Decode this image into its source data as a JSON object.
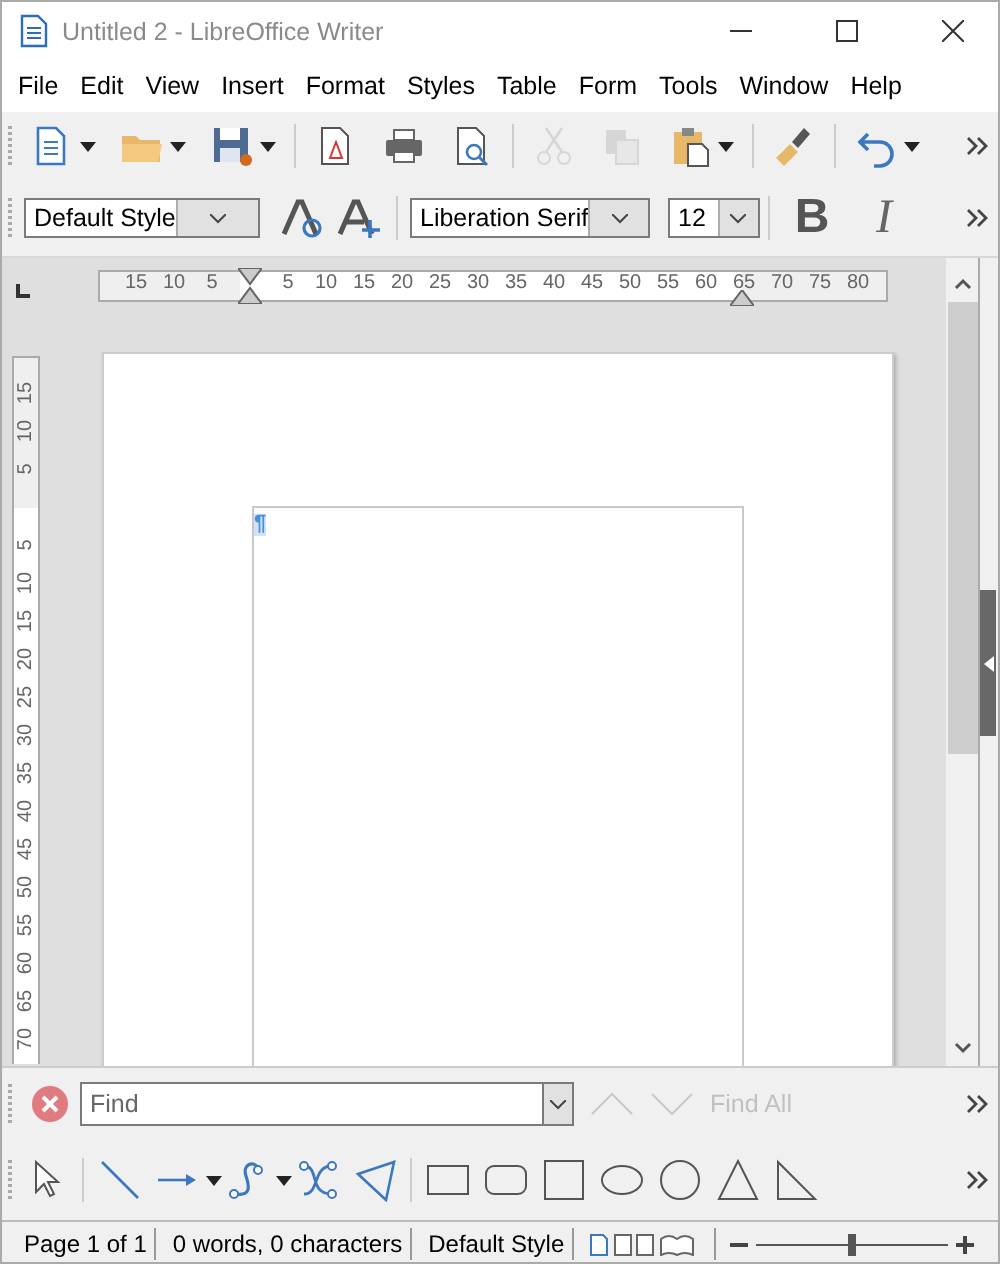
{
  "window": {
    "title": "Untitled 2 - LibreOffice Writer"
  },
  "menu": [
    "File",
    "Edit",
    "View",
    "Insert",
    "Format",
    "Styles",
    "Table",
    "Form",
    "Tools",
    "Window",
    "Help"
  ],
  "standard_toolbar": [
    [
      {
        "kind": "new",
        "dropdown": true,
        "disabled": false
      },
      {
        "kind": "open",
        "dropdown": true,
        "disabled": false
      },
      {
        "kind": "save",
        "dropdown": true,
        "disabled": false
      }
    ],
    [
      {
        "kind": "pdf",
        "dropdown": false,
        "disabled": false
      },
      {
        "kind": "print",
        "dropdown": false,
        "disabled": false
      },
      {
        "kind": "preview",
        "dropdown": false,
        "disabled": false
      }
    ],
    [
      {
        "kind": "cut",
        "dropdown": false,
        "disabled": true
      },
      {
        "kind": "copy",
        "dropdown": false,
        "disabled": true
      },
      {
        "kind": "paste",
        "dropdown": true,
        "disabled": false
      }
    ],
    [
      {
        "kind": "clone",
        "dropdown": false,
        "disabled": false
      }
    ],
    [
      {
        "kind": "undo",
        "dropdown": true,
        "disabled": false
      }
    ]
  ],
  "formatting_toolbar": {
    "paragraph_style": "Default Style",
    "font_name": "Liberation Serif",
    "font_size": "12",
    "bold": "B",
    "italic": "I"
  },
  "ruler": {
    "left_labels": [
      "15",
      "10",
      "5"
    ],
    "right_labels": [
      "5",
      "10",
      "15",
      "20",
      "25",
      "30",
      "35",
      "40",
      "45",
      "50",
      "55",
      "60",
      "65",
      "70",
      "75",
      "80"
    ]
  },
  "vertical_ruler": {
    "top_labels": [
      "15",
      "10",
      "5"
    ],
    "bottom_labels": [
      "5",
      "10",
      "15",
      "20",
      "25",
      "30",
      "35",
      "40",
      "45",
      "50",
      "55",
      "60",
      "65",
      "70"
    ]
  },
  "document": {
    "pilcrow": "¶"
  },
  "find_bar": {
    "placeholder": "Find",
    "find_all": "Find All",
    "navigation_disabled": true
  },
  "drawing_toolbar": [
    [
      {
        "kind": "select",
        "dropdown": false
      }
    ],
    [
      {
        "kind": "line",
        "dropdown": false
      },
      {
        "kind": "arrow",
        "dropdown": true
      },
      {
        "kind": "curve",
        "dropdown": true
      },
      {
        "kind": "points",
        "dropdown": false
      },
      {
        "kind": "polygon",
        "dropdown": false
      }
    ],
    [
      {
        "kind": "rectangle",
        "dropdown": false
      },
      {
        "kind": "rounded",
        "dropdown": false
      },
      {
        "kind": "square",
        "dropdown": false
      },
      {
        "kind": "ellipse",
        "dropdown": false
      },
      {
        "kind": "circle",
        "dropdown": false
      },
      {
        "kind": "triangle",
        "dropdown": false
      },
      {
        "kind": "right_triangle",
        "dropdown": false
      }
    ]
  ],
  "status_bar": {
    "page": "Page 1 of 1",
    "words": "0 words, 0 characters",
    "style": "Default Style",
    "zoom": {
      "level": 0.5
    }
  }
}
